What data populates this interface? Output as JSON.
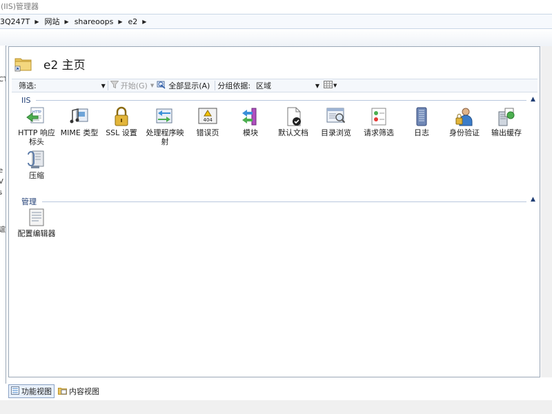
{
  "window": {
    "title": "(IIS)管理器"
  },
  "address": {
    "crumbs": [
      "3Q247T",
      "网站",
      "shareoops",
      "e2"
    ]
  },
  "leftpane": {
    "fragments": [
      "CT",
      "e",
      "V",
      "s",
      "谊"
    ]
  },
  "page": {
    "title": "e2 主页"
  },
  "toolbar": {
    "filter_label": "筛选:",
    "filter_value": "",
    "start_label": "开始(G)",
    "show_all_label": "全部显示(A)",
    "group_by_label": "分组依据:",
    "group_by_value": "区域"
  },
  "sections": [
    {
      "title": "IIS",
      "items": [
        {
          "label": "HTTP 响应标头",
          "icon": "http-response-headers-icon"
        },
        {
          "label": "MIME 类型",
          "icon": "mime-types-icon"
        },
        {
          "label": "SSL 设置",
          "icon": "ssl-settings-icon"
        },
        {
          "label": "处理程序映射",
          "icon": "handler-mappings-icon"
        },
        {
          "label": "错误页",
          "icon": "error-pages-icon"
        },
        {
          "label": "模块",
          "icon": "modules-icon"
        },
        {
          "label": "默认文档",
          "icon": "default-document-icon"
        },
        {
          "label": "目录浏览",
          "icon": "directory-browsing-icon"
        },
        {
          "label": "请求筛选",
          "icon": "request-filtering-icon"
        },
        {
          "label": "日志",
          "icon": "logging-icon"
        },
        {
          "label": "身份验证",
          "icon": "authentication-icon"
        },
        {
          "label": "输出缓存",
          "icon": "output-caching-icon"
        },
        {
          "label": "压缩",
          "icon": "compression-icon"
        }
      ]
    },
    {
      "title": "管理",
      "items": [
        {
          "label": "配置编辑器",
          "icon": "configuration-editor-icon"
        }
      ]
    }
  ],
  "bottom_tabs": [
    {
      "label": "功能视图",
      "active": true
    },
    {
      "label": "内容视图",
      "active": false
    }
  ],
  "error_page_code": "404"
}
